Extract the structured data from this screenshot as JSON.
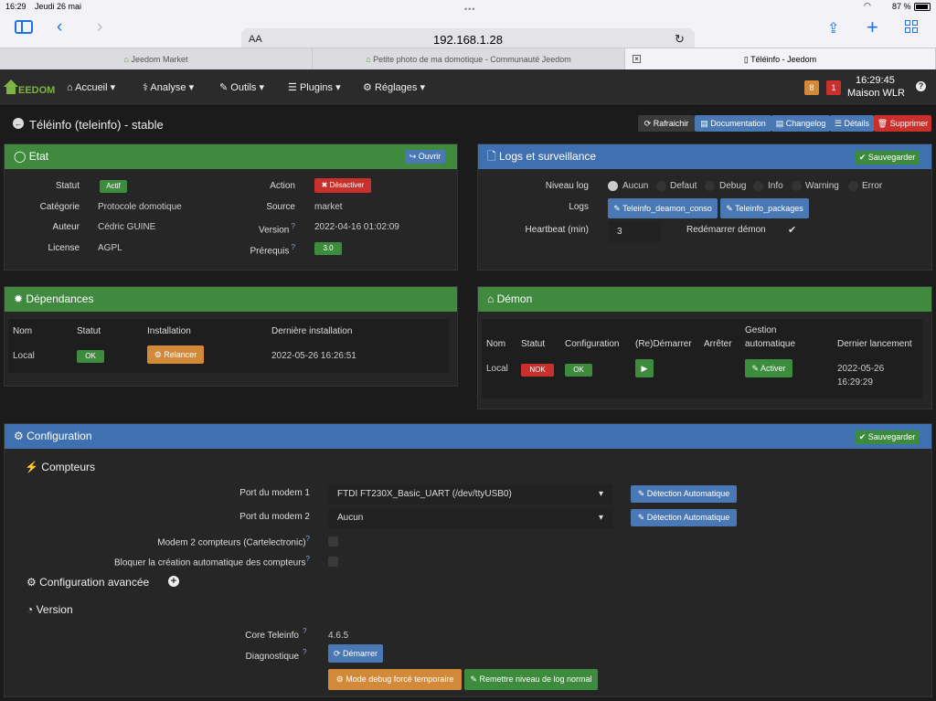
{
  "statusbar": {
    "time": "16:29",
    "date": "Jeudi 26 mai",
    "battery": "87 %"
  },
  "safari": {
    "text_size": "AA",
    "url": "192.168.1.28",
    "tabs": [
      {
        "label": "Jeedom Market"
      },
      {
        "label": "Petite photo de ma domotique - Communauté Jeedom"
      },
      {
        "label": "Téléinfo - Jeedom"
      }
    ]
  },
  "nav": {
    "logo": "EEDOM",
    "menu": [
      {
        "label": "Accueil"
      },
      {
        "label": "Analyse"
      },
      {
        "label": "Outils"
      },
      {
        "label": "Plugins"
      },
      {
        "label": "Réglages"
      }
    ],
    "badge_warning": "8",
    "badge_danger": "1",
    "clock": "16:29:45",
    "site": "Maison WLR"
  },
  "page": {
    "title": "Téléinfo (teleinfo) - stable",
    "actions": {
      "refresh": "Rafraichir",
      "doc": "Documentation",
      "changelog": "Changelog",
      "details": "Détails",
      "delete": "Supprimer"
    }
  },
  "etat": {
    "title": "Etat",
    "open": "Ouvrir",
    "statut_label": "Statut",
    "statut_value": "Actif",
    "action_label": "Action",
    "action_value": "Désactiver",
    "categorie_label": "Catégorie",
    "categorie_value": "Protocole domotique",
    "source_label": "Source",
    "source_value": "market",
    "auteur_label": "Auteur",
    "auteur_value": "Cédric GUINE",
    "version_label": "Version",
    "version_value": "2022-04-16 01:02:09",
    "license_label": "License",
    "license_value": "AGPL",
    "prereq_label": "Prérequis",
    "prereq_value": "3.0"
  },
  "logs": {
    "title": "Logs et surveillance",
    "save": "Sauvegarder",
    "niveau_label": "Niveau log",
    "levels": [
      "Aucun",
      "Defaut",
      "Debug",
      "Info",
      "Warning",
      "Error"
    ],
    "logs_label": "Logs",
    "log_buttons": [
      "Teleinfo_deamon_conso",
      "Teleinfo_packages"
    ],
    "heartbeat_label": "Heartbeat (min)",
    "heartbeat_value": "3",
    "restart_label": "Redémarrer démon"
  },
  "deps": {
    "title": "Dépendances",
    "headers": {
      "nom": "Nom",
      "statut": "Statut",
      "install": "Installation",
      "last": "Dernière installation"
    },
    "row": {
      "nom": "Local",
      "statut": "OK",
      "action": "Relancer",
      "last": "2022-05-26 16:26:51"
    }
  },
  "demon": {
    "title": "Démon",
    "headers": {
      "nom": "Nom",
      "statut": "Statut",
      "config": "Configuration",
      "start": "(Re)Démarrer",
      "stop": "Arrêter",
      "gestion1": "Gestion",
      "gestion2": "automatique",
      "last": "Dernier lancement"
    },
    "row": {
      "nom": "Local",
      "statut": "NOK",
      "config": "OK",
      "activer": "Activer",
      "last1": "2022-05-26",
      "last2": "16:29:29"
    }
  },
  "config": {
    "title": "Configuration",
    "save": "Sauvegarder",
    "compteurs": "Compteurs",
    "port1_label": "Port du modem 1",
    "port1_value": "FTDI FT230X_Basic_UART (/dev/ttyUSB0)",
    "port2_label": "Port du modem 2",
    "port2_value": "Aucun",
    "detect": "Détection Automatique",
    "modem2_label": "Modem 2 compteurs (Cartelectronic)",
    "block_label": "Bloquer la création automatique des compteurs",
    "advanced": "Configuration avancée",
    "version_title": "Version",
    "core_label": "Core Teleinfo",
    "core_value": "4.6.5",
    "diag_label": "Diagnostique",
    "start_btn": "Démarrer",
    "debug_btn": "Mode debug forcé temporaire",
    "reset_btn": "Remettre niveau de log normal"
  },
  "colors": {
    "green": "#3f8a3f",
    "blue": "#3f70b0",
    "red": "#c9302c",
    "orange": "#d28a3a"
  }
}
